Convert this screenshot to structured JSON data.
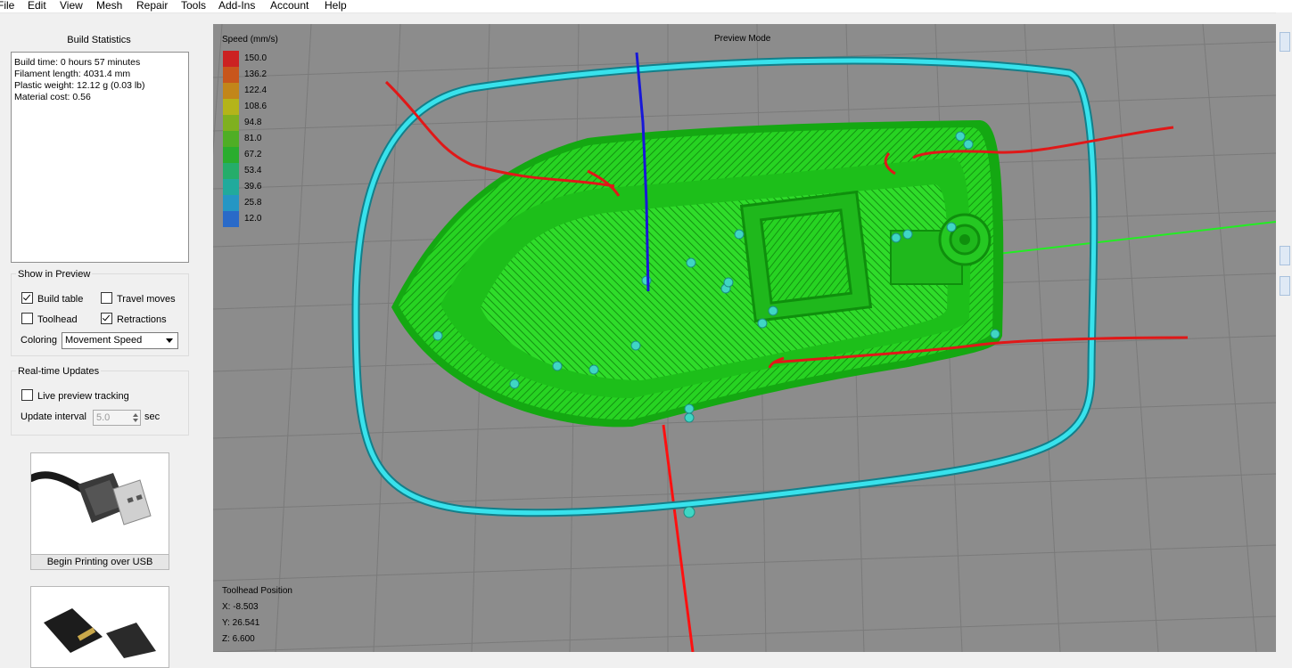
{
  "menu": [
    "File",
    "Edit",
    "View",
    "Mesh",
    "Repair",
    "Tools",
    "Add-Ins",
    "Account",
    "Help"
  ],
  "build_stats": {
    "title": "Build Statistics",
    "lines": [
      "Build time: 0 hours 57 minutes",
      "Filament length: 4031.4 mm",
      "Plastic weight: 12.12 g (0.03 lb)",
      "Material cost: 0.56"
    ]
  },
  "preview": {
    "title": "Show in Preview",
    "build_table": {
      "label": "Build table",
      "checked": true
    },
    "travel_moves": {
      "label": "Travel moves",
      "checked": false
    },
    "toolhead": {
      "label": "Toolhead",
      "checked": false
    },
    "retractions": {
      "label": "Retractions",
      "checked": true
    },
    "coloring_label": "Coloring",
    "coloring_value": "Movement Speed"
  },
  "realtime": {
    "title": "Real-time Updates",
    "live_tracking": {
      "label": "Live preview tracking",
      "checked": false
    },
    "interval_label": "Update interval",
    "interval_value": "5.0",
    "interval_unit": "sec"
  },
  "buttons": {
    "usb": "Begin Printing over USB"
  },
  "viewport": {
    "mode": "Preview Mode",
    "legend_title": "Speed (mm/s)",
    "legend": [
      {
        "value": "150.0",
        "color": "#cc2222"
      },
      {
        "value": "136.2",
        "color": "#c8561c"
      },
      {
        "value": "122.4",
        "color": "#c2861a"
      },
      {
        "value": "108.6",
        "color": "#b4b41a"
      },
      {
        "value": "94.8",
        "color": "#7fb01f"
      },
      {
        "value": "81.0",
        "color": "#4fae25"
      },
      {
        "value": "67.2",
        "color": "#2aad2e"
      },
      {
        "value": "53.4",
        "color": "#25ad6a"
      },
      {
        "value": "39.6",
        "color": "#21aa9c"
      },
      {
        "value": "25.8",
        "color": "#2596c4"
      },
      {
        "value": "12.0",
        "color": "#2a6ac8"
      }
    ],
    "toolhead": {
      "title": "Toolhead Position",
      "x": "X: -8.503",
      "y": "Y: 26.541",
      "z": "Z: 6.600"
    }
  }
}
